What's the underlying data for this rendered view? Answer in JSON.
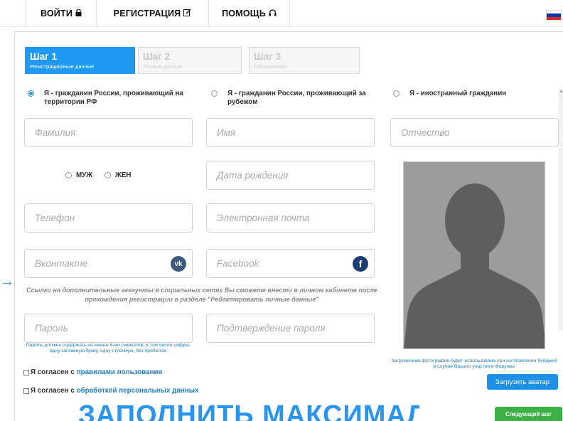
{
  "nav": {
    "login": "ВОЙТИ",
    "register": "РЕГИСТРАЦИЯ",
    "help": "ПОМОЩЬ",
    "login_icon": "lock-icon",
    "register_icon": "edit-icon",
    "help_icon": "headset-icon"
  },
  "flag": {
    "icon": "russia-flag-icon",
    "colors": [
      "#ffffff",
      "#0039a6",
      "#d52b1e"
    ]
  },
  "steps": [
    {
      "title": "Шаг 1",
      "subtitle": "Регистрационные данные",
      "active": true
    },
    {
      "title": "Шаг 2",
      "subtitle": "Личные данные",
      "active": false
    },
    {
      "title": "Шаг 3",
      "subtitle": "Образование",
      "active": false
    }
  ],
  "citizenship": [
    {
      "label": "Я - гражданин России, проживающий на территории РФ",
      "checked": true
    },
    {
      "label": "Я - гражданин России, проживающий за рубежом",
      "checked": false
    },
    {
      "label": "Я - иностранный гражданин",
      "checked": false
    }
  ],
  "fields": {
    "surname": "Фамилия",
    "name": "Имя",
    "patronymic": "Отчество",
    "birth_date": "Дата рождения",
    "phone": "Телефон",
    "email": "Электронная почта",
    "vk": "Вконтакте",
    "facebook": "Facebook",
    "password": "Пароль",
    "password_confirm": "Подтверждение пароля"
  },
  "gender": {
    "male": "МУЖ",
    "female": "ЖЕН"
  },
  "social_note": "Ссылки на дополнительные аккаунты в социальных сетях Вы сможете внести в личном кабинете после прохождения регистрации в разделе \"Редактировать личные данные\"",
  "password_note": "Пароль должен содержать не менее 8-ми символов, в том числе цифры, одну заглавную букву, одну строчную, без пробелов.",
  "agreements": [
    {
      "prefix": "Я согласен с",
      "link": "правилами пользования"
    },
    {
      "prefix": "Я согласен с",
      "link": "обработкой персональных данных"
    }
  ],
  "avatar_note": "Загруженная фотография будет использована при изготовлении бейджей в случае Вашего участия в Форумах",
  "upload_button": "Загрузить аватар",
  "next_button": "Следующий шаг",
  "banner_text": "ЗАПОЛНИТЬ МАКСИМАЛЬНОЕ",
  "colors": {
    "accent": "#1e9af2",
    "link": "#1e7fc8",
    "next": "#3cb043"
  }
}
